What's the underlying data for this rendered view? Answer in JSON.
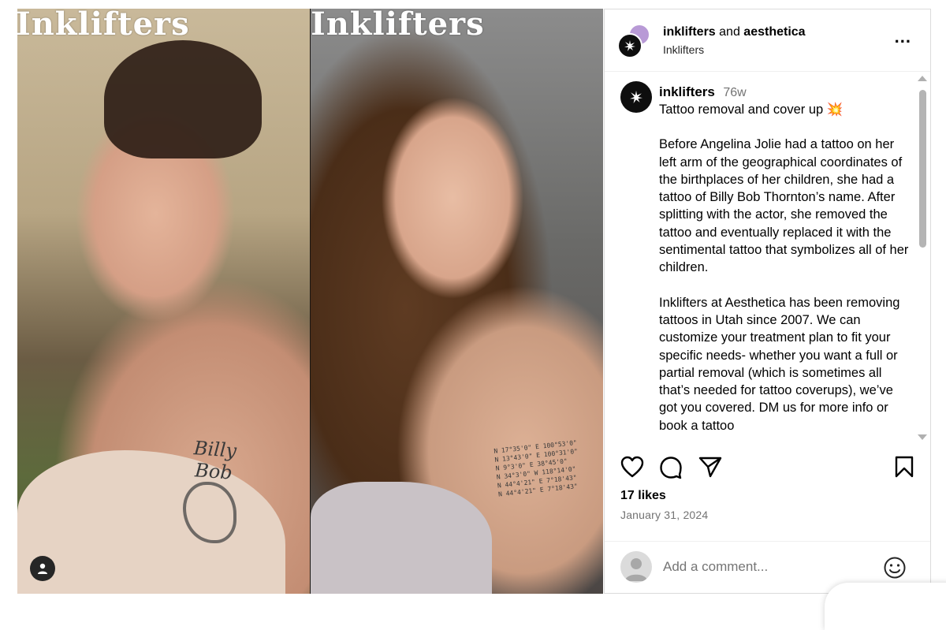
{
  "media": {
    "watermark_left": "Inklifters",
    "watermark_right": "Inklifters",
    "tattoo_left_text": "Billy Bob",
    "tattoo_right_lines": [
      "N 17°35'0\"  E 100°53'0\"",
      "N 13°43'0\"  E 100°31'0\"",
      "N 9°3'0\"  E 38°45'0\"",
      "N 34°3'0\"  W 118°14'0\"",
      "N 44°4'21\"  E 7°18'43\"",
      "N 44°4'21\"  E 7°18'43\""
    ]
  },
  "header": {
    "account_primary": "inklifters",
    "and_word": "and",
    "account_secondary": "aesthetica",
    "subtitle": "Inklifters",
    "more_label": "..."
  },
  "caption": {
    "username": "inklifters",
    "time": "76w",
    "first_line": "Tattoo removal and cover up 💥",
    "paragraph_1": "Before Angelina Jolie had a tattoo on her left arm of the geographical coordinates of the birthplaces of her children, she had a tattoo of Billy Bob Thornton’s name. After splitting with the actor, she removed the tattoo and eventually replaced it with the sentimental tattoo that symbolizes all of her children.",
    "paragraph_2": "Inklifters at Aesthetica has been removing tattoos in Utah since 2007. We can customize your treatment plan to fit your specific needs- whether you want a full or partial removal (which is sometimes all that’s needed for tattoo coverups), we’ve got you covered. DM us for more info or book a tattoo"
  },
  "stats": {
    "likes": "17 likes",
    "date": "January 31, 2024"
  },
  "comment": {
    "placeholder": "Add a comment..."
  },
  "icons": {
    "like": "heart-icon",
    "comment": "comment-icon",
    "share": "send-icon",
    "save": "bookmark-icon",
    "emoji": "emoji-icon",
    "more": "more-options-icon",
    "user_tag": "user-tag-icon"
  }
}
